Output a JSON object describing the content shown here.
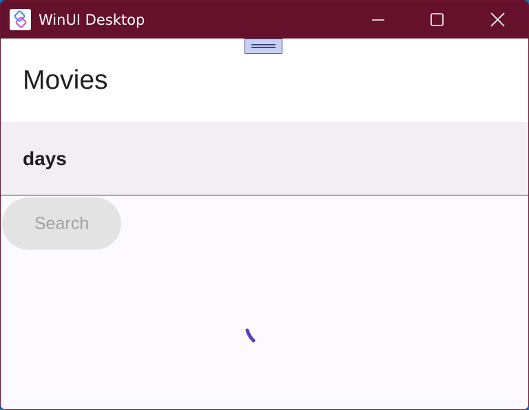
{
  "window": {
    "title": "WinUI Desktop",
    "accent_color": "#65112c",
    "icon": "winui-app-icon"
  },
  "caption_buttons": {
    "minimize_icon": "minimize-icon",
    "maximize_icon": "maximize-icon",
    "close_icon": "close-icon"
  },
  "page": {
    "title": "Movies",
    "drag_handle_icon": "drag-handle-icon"
  },
  "search": {
    "value": "days",
    "button_label": "Search",
    "button_enabled": false
  },
  "loading": {
    "icon": "progress-ring-icon",
    "spinner_color": "#5b3fc4"
  }
}
